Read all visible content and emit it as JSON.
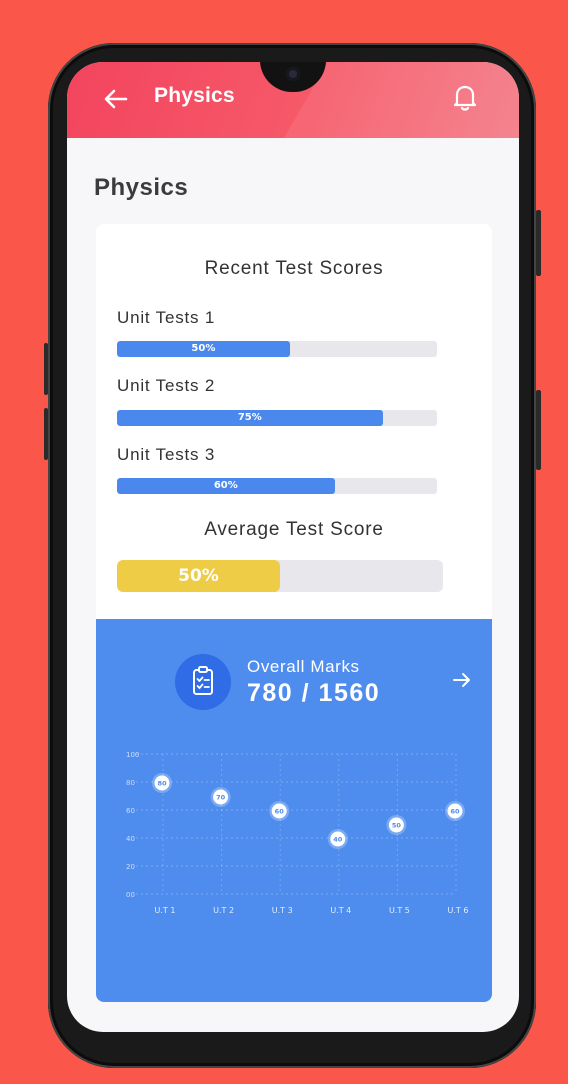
{
  "header": {
    "title": "Physics"
  },
  "page": {
    "title": "Physics"
  },
  "scores_card": {
    "heading": "Recent Test Scores",
    "tests": [
      {
        "label": "Unit Tests 1",
        "percent_text": "50%",
        "value": 0.54
      },
      {
        "label": "Unit Tests 2",
        "percent_text": "75%",
        "value": 0.83
      },
      {
        "label": "Unit Tests 3",
        "percent_text": "60%",
        "value": 0.68
      }
    ],
    "average_heading": "Average Test Score",
    "average": {
      "percent_text": "50%",
      "value": 0.5
    }
  },
  "overall": {
    "label": "Overall Marks",
    "value": "780 / 1560"
  },
  "colors": {
    "header": "#f4475f",
    "bar_blue": "#4a88ed",
    "bar_yellow": "#efcc45",
    "panel_blue": "#4e8cee",
    "background": "#fa574a"
  },
  "icons": {
    "back": "arrow-left-icon",
    "notification": "bell-icon",
    "overall": "clipboard-check-icon",
    "open": "arrow-right-icon"
  },
  "chart_data": {
    "type": "scatter",
    "categories": [
      "U.T 1",
      "U.T 2",
      "U.T 3",
      "U.T 4",
      "U.T 5",
      "U.T 6"
    ],
    "values": [
      80,
      70,
      60,
      40,
      50,
      60
    ],
    "y_ticks": [
      "00",
      "20",
      "40",
      "60",
      "80",
      "100"
    ],
    "ylim": [
      0,
      100
    ],
    "grid": true,
    "title": "",
    "xlabel": "",
    "ylabel": ""
  }
}
